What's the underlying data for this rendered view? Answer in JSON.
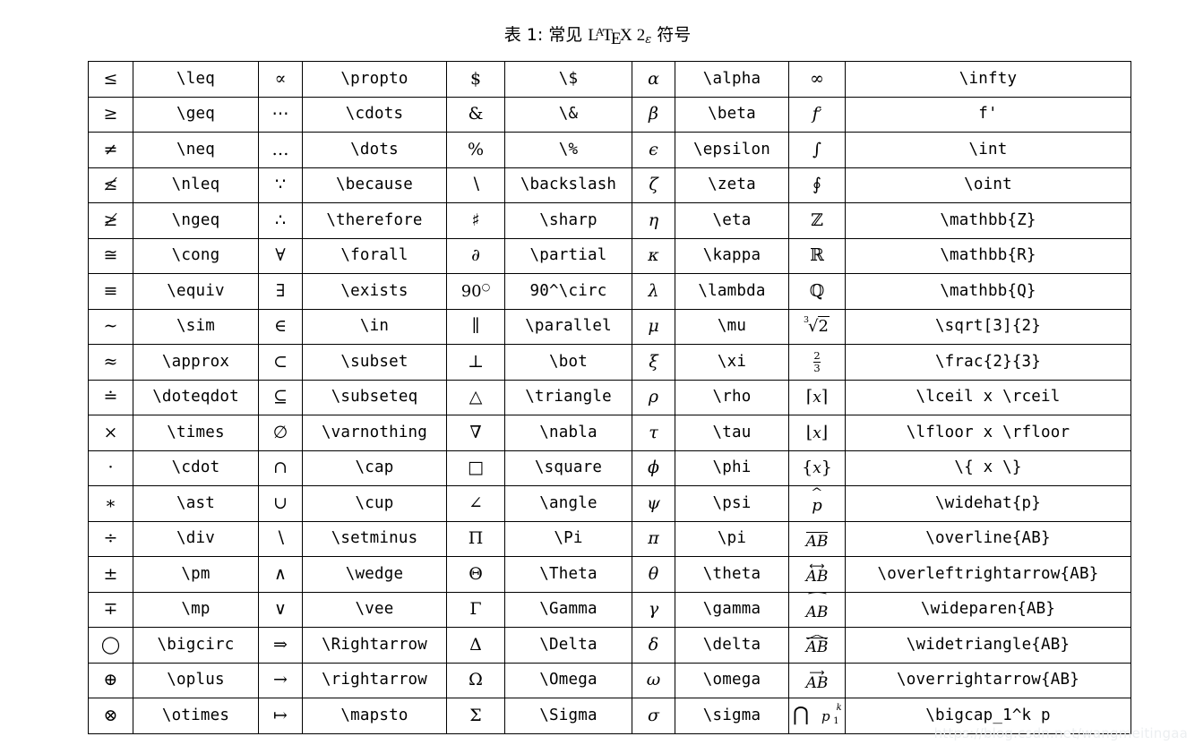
{
  "caption": {
    "prefix": "表 1: 常见",
    "logo": {
      "la": "L",
      "a": "A",
      "t": "T",
      "e": "E",
      "x": "X",
      "two": "2",
      "eps": "ε"
    },
    "suffix": "符号"
  },
  "watermark": "https://blog.csdn.net/wangmeitingaa",
  "table": {
    "columns": 10,
    "rows": 19,
    "pairs": [
      {
        "id": "relations",
        "entries": [
          {
            "symbol": "≤",
            "code": "\\leq"
          },
          {
            "symbol": "≥",
            "code": "\\geq"
          },
          {
            "symbol": "≠",
            "code": "\\neq"
          },
          {
            "symbol": "≰",
            "code": "\\nleq"
          },
          {
            "symbol": "≱",
            "code": "\\ngeq"
          },
          {
            "symbol": "≅",
            "code": "\\cong"
          },
          {
            "symbol": "≡",
            "code": "\\equiv"
          },
          {
            "symbol": "∼",
            "code": "\\sim"
          },
          {
            "symbol": "≈",
            "code": "\\approx"
          },
          {
            "symbol": "≐",
            "code": "\\doteqdot"
          },
          {
            "symbol": "×",
            "code": "\\times"
          },
          {
            "symbol": "·",
            "code": "\\cdot"
          },
          {
            "symbol": "∗",
            "code": "\\ast"
          },
          {
            "symbol": "÷",
            "code": "\\div"
          },
          {
            "symbol": "±",
            "code": "\\pm"
          },
          {
            "symbol": "∓",
            "code": "\\mp"
          },
          {
            "symbol": "◯",
            "code": "\\bigcirc"
          },
          {
            "symbol": "⊕",
            "code": "\\oplus"
          },
          {
            "symbol": "⊗",
            "code": "\\otimes"
          }
        ]
      },
      {
        "id": "logic-sets",
        "entries": [
          {
            "symbol": "∝",
            "code": "\\propto"
          },
          {
            "symbol": "⋯",
            "code": "\\cdots"
          },
          {
            "symbol": "…",
            "code": "\\dots"
          },
          {
            "symbol": "∵",
            "code": "\\because"
          },
          {
            "symbol": "∴",
            "code": "\\therefore"
          },
          {
            "symbol": "∀",
            "code": "\\forall"
          },
          {
            "symbol": "∃",
            "code": "\\exists"
          },
          {
            "symbol": "∈",
            "code": "\\in"
          },
          {
            "symbol": "⊂",
            "code": "\\subset"
          },
          {
            "symbol": "⊆",
            "code": "\\subseteq"
          },
          {
            "symbol": "∅",
            "code": "\\varnothing"
          },
          {
            "symbol": "∩",
            "code": "\\cap"
          },
          {
            "symbol": "∪",
            "code": "\\cup"
          },
          {
            "symbol": "∖",
            "code": "\\setminus"
          },
          {
            "symbol": "∧",
            "code": "\\wedge"
          },
          {
            "symbol": "∨",
            "code": "\\vee"
          },
          {
            "symbol": "⇒",
            "code": "\\Rightarrow"
          },
          {
            "symbol": "→",
            "code": "\\rightarrow"
          },
          {
            "symbol": "↦",
            "code": "\\mapsto"
          }
        ]
      },
      {
        "id": "specials-uppercase-greek",
        "entries": [
          {
            "symbol": "$",
            "code": "\\$"
          },
          {
            "symbol": "&",
            "code": "\\&"
          },
          {
            "symbol": "%",
            "code": "\\%"
          },
          {
            "symbol": "∖",
            "code": "\\backslash"
          },
          {
            "symbol": "♯",
            "code": "\\sharp"
          },
          {
            "symbol": "∂",
            "code": "\\partial"
          },
          {
            "symbol": "90°",
            "code": "90^\\circ"
          },
          {
            "symbol": "∥",
            "code": "\\parallel"
          },
          {
            "symbol": "⊥",
            "code": "\\bot"
          },
          {
            "symbol": "△",
            "code": "\\triangle"
          },
          {
            "symbol": "∇",
            "code": "\\nabla"
          },
          {
            "symbol": "□",
            "code": "\\square"
          },
          {
            "symbol": "∠",
            "code": "\\angle"
          },
          {
            "symbol": "Π",
            "code": "\\Pi"
          },
          {
            "symbol": "Θ",
            "code": "\\Theta"
          },
          {
            "symbol": "Γ",
            "code": "\\Gamma"
          },
          {
            "symbol": "Δ",
            "code": "\\Delta"
          },
          {
            "symbol": "Ω",
            "code": "\\Omega"
          },
          {
            "symbol": "Σ",
            "code": "\\Sigma"
          }
        ]
      },
      {
        "id": "lowercase-greek",
        "entries": [
          {
            "symbol": "α",
            "code": "\\alpha"
          },
          {
            "symbol": "β",
            "code": "\\beta"
          },
          {
            "symbol": "ϵ",
            "code": "\\epsilon"
          },
          {
            "symbol": "ζ",
            "code": "\\zeta"
          },
          {
            "symbol": "η",
            "code": "\\eta"
          },
          {
            "symbol": "κ",
            "code": "\\kappa"
          },
          {
            "symbol": "λ",
            "code": "\\lambda"
          },
          {
            "symbol": "μ",
            "code": "\\mu"
          },
          {
            "symbol": "ξ",
            "code": "\\xi"
          },
          {
            "symbol": "ρ",
            "code": "\\rho"
          },
          {
            "symbol": "τ",
            "code": "\\tau"
          },
          {
            "symbol": "ϕ",
            "code": "\\phi"
          },
          {
            "symbol": "ψ",
            "code": "\\psi"
          },
          {
            "symbol": "π",
            "code": "\\pi"
          },
          {
            "symbol": "θ",
            "code": "\\theta"
          },
          {
            "symbol": "γ",
            "code": "\\gamma"
          },
          {
            "symbol": "δ",
            "code": "\\delta"
          },
          {
            "symbol": "ω",
            "code": "\\omega"
          },
          {
            "symbol": "σ",
            "code": "\\sigma"
          }
        ]
      },
      {
        "id": "operators-accents",
        "entries": [
          {
            "symbol": "∞",
            "code": "\\infty"
          },
          {
            "symbol": "f′",
            "code": "f'"
          },
          {
            "symbol": "∫",
            "code": "\\int"
          },
          {
            "symbol": "∮",
            "code": "\\oint"
          },
          {
            "symbol": "ℤ",
            "code": "\\mathbb{Z}"
          },
          {
            "symbol": "ℝ",
            "code": "\\mathbb{R}"
          },
          {
            "symbol": "ℚ",
            "code": "\\mathbb{Q}"
          },
          {
            "symbol": "∛2",
            "code": "\\sqrt[3]{2}"
          },
          {
            "symbol": "2/3",
            "code": "\\frac{2}{3}"
          },
          {
            "symbol": "⌈x⌉",
            "code": "\\lceil x \\rceil"
          },
          {
            "symbol": "⌊x⌋",
            "code": "\\lfloor x \\rfloor"
          },
          {
            "symbol": "{x}",
            "code": "\\{ x \\}"
          },
          {
            "symbol": "p̂",
            "code": "\\widehat{p}"
          },
          {
            "symbol": "AB̅",
            "code": "\\overline{AB}"
          },
          {
            "symbol": "AB⃡",
            "code": "\\overleftrightarrow{AB}"
          },
          {
            "symbol": "AB͡",
            "code": "\\wideparen{AB}"
          },
          {
            "symbol": "AB̂",
            "code": "\\widetriangle{AB}"
          },
          {
            "symbol": "AB⃗",
            "code": "\\overrightarrow{AB}"
          },
          {
            "symbol": "⋂_1^k p",
            "code": "\\bigcap_1^k p"
          }
        ]
      }
    ]
  }
}
